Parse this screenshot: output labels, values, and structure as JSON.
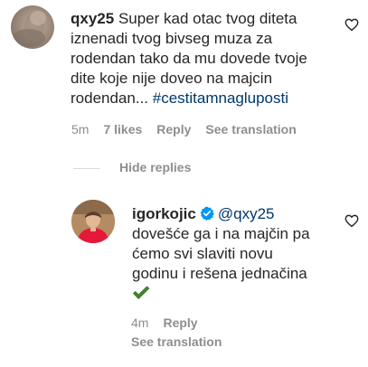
{
  "comment": {
    "username": "qxy25",
    "text_lines": [
      "Super kad otac tvog diteta",
      "iznenadi tvog bivseg muza za",
      "rodendan tako da mu dovede tvoje",
      "dite koje nije doveo na majcin",
      "rodendan... "
    ],
    "hashtag": "#cestitamnaglupostі",
    "time": "5m",
    "likes": "7 likes",
    "reply": "Reply",
    "see_translation": "See translation"
  },
  "hide_replies": "Hide replies",
  "reply": {
    "username": "igorkojic",
    "mention": "@qxy25",
    "text_lines": [
      "dovešće ga i na majčin pa",
      "ćemo svi slaviti novu",
      "godinu i rešena jednačina"
    ],
    "emoji": "check-mark",
    "time": "4m",
    "reply": "Reply",
    "see_translation": "See translation"
  },
  "icons": {
    "heart": "heart-outline-icon",
    "verified": "verified-badge-icon",
    "check": "heavy-check-mark-icon"
  },
  "colors": {
    "text": "#262626",
    "secondary": "#8e8e8e",
    "link": "#00376b",
    "verified": "#0095f6",
    "check": "#2e7d32"
  }
}
